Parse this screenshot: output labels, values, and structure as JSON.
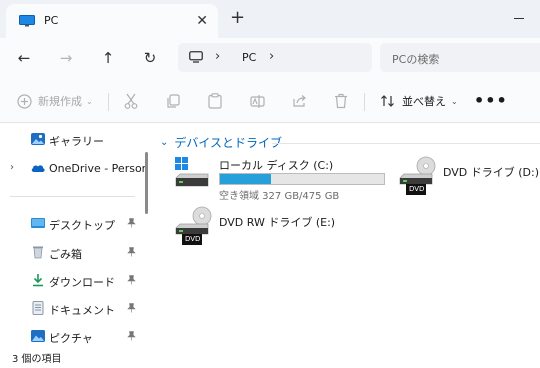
{
  "tab": {
    "title": "PC",
    "close_glyph": "✕"
  },
  "new_tab_glyph": "+",
  "nav": {
    "back": "←",
    "forward": "→",
    "up": "↑",
    "refresh": "↻"
  },
  "address": {
    "sep": "›",
    "crumb": "PC"
  },
  "search": {
    "placeholder": "PCの検索"
  },
  "toolbar": {
    "new_label": "新規作成",
    "sort_label": "並べ替え",
    "more_glyph": "•••",
    "chevron": "⌄"
  },
  "sidebar": {
    "items": [
      {
        "label": "ギャラリー",
        "icon": "gallery-icon",
        "chevron": "",
        "pinned": false
      },
      {
        "label": "OneDrive - Persona",
        "icon": "onedrive-icon",
        "chevron": "›",
        "pinned": false
      },
      {
        "label": "デスクトップ",
        "icon": "desktop-icon",
        "chevron": "",
        "pinned": true
      },
      {
        "label": "ごみ箱",
        "icon": "recycle-bin-icon",
        "chevron": "",
        "pinned": true
      },
      {
        "label": "ダウンロード",
        "icon": "download-icon",
        "chevron": "",
        "pinned": true
      },
      {
        "label": "ドキュメント",
        "icon": "document-icon",
        "chevron": "",
        "pinned": true
      },
      {
        "label": "ピクチャ",
        "icon": "pictures-icon",
        "chevron": "",
        "pinned": true
      }
    ],
    "pin_glyph": "📌"
  },
  "content": {
    "group_title": "デバイスとドライブ",
    "group_chevron": "⌄",
    "drives": [
      {
        "name": "ローカル ディスク (C:)",
        "space": "空き領域 327 GB/475 GB",
        "used_fraction": 0.31,
        "icon": "windows-drive-icon"
      },
      {
        "name": "DVD ドライブ (D:)",
        "icon": "dvd-drive-icon",
        "badge": "DVD"
      },
      {
        "name": "DVD RW ドライブ (E:)",
        "icon": "dvd-rw-drive-icon",
        "badge": "DVD"
      }
    ]
  },
  "status": {
    "text": "3 個の項目"
  },
  "colors": {
    "accent": "#0067c0",
    "progress": "#26a0da"
  }
}
